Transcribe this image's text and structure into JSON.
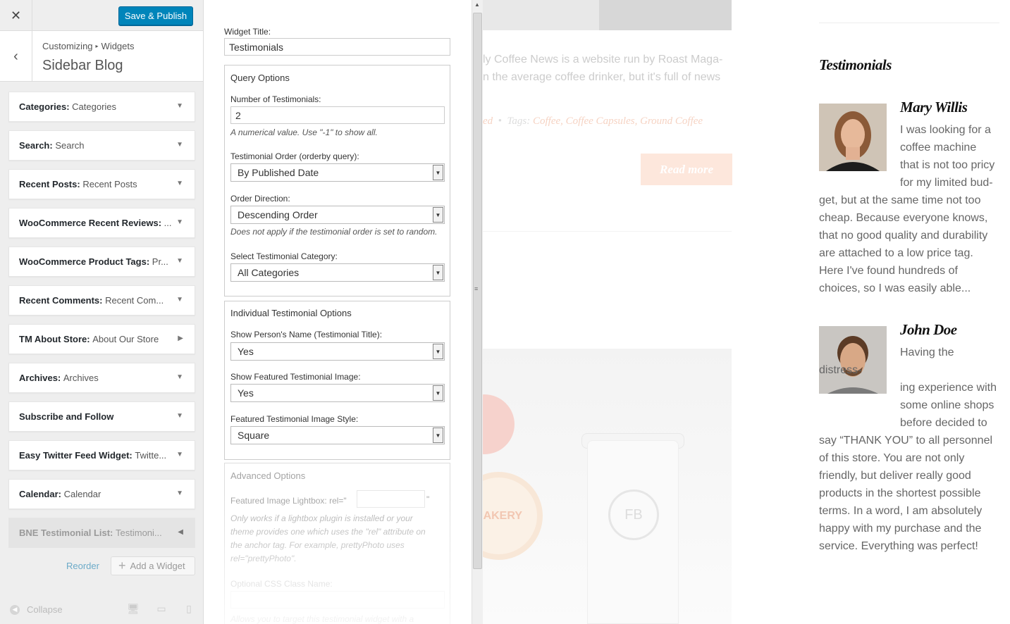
{
  "topbar": {
    "close_icon": "close-icon",
    "publish_label": "Save & Publish"
  },
  "header": {
    "crumb_1": "Customizing",
    "crumb_sep": "▸",
    "crumb_2": "Widgets",
    "title": "Sidebar Blog"
  },
  "widgets": [
    {
      "type": "Categories:",
      "title": "Categories",
      "arrow": "▼"
    },
    {
      "type": "Search:",
      "title": "Search",
      "arrow": "▼"
    },
    {
      "type": "Recent Posts:",
      "title": "Recent Posts",
      "arrow": "▼"
    },
    {
      "type": "WooCommerce Recent Reviews:",
      "title": "...",
      "arrow": "▼"
    },
    {
      "type": "WooCommerce Product Tags:",
      "title": "Pr...",
      "arrow": "▼"
    },
    {
      "type": "Recent Comments:",
      "title": "Recent Com...",
      "arrow": "▼"
    },
    {
      "type": "TM About Store:",
      "title": "About Our Store",
      "arrow": "▶"
    },
    {
      "type": "Archives:",
      "title": "Archives",
      "arrow": "▼"
    },
    {
      "type": "Subscribe and Follow",
      "title": "",
      "arrow": "▼"
    },
    {
      "type": "Easy Twitter Feed Widget:",
      "title": "Twitte...",
      "arrow": "▼"
    },
    {
      "type": "Calendar:",
      "title": "Calendar",
      "arrow": "▼"
    },
    {
      "type": "BNE Testimonial List:",
      "title": "Testimoni...",
      "arrow": "◀"
    }
  ],
  "widget_actions": {
    "reorder": "Reorder",
    "add_widget": "Add a Widget"
  },
  "footer": {
    "collapse": "Collapse"
  },
  "form": {
    "widget_title_label": "Widget Title:",
    "widget_title_value": "Testimonials",
    "query_heading": "Query Options",
    "num_label": "Number of Testimonials:",
    "num_value": "2",
    "num_hint": "A numerical value. Use \"-1\" to show all.",
    "order_label": "Testimonial Order (orderby query):",
    "order_value": "By Published Date",
    "direction_label": "Order Direction:",
    "direction_value": "Descending Order",
    "direction_hint": "Does not apply if the testimonial order is set to random.",
    "category_label": "Select Testimonial Category:",
    "category_value": "All Categories",
    "individual_heading": "Individual Testimonial Options",
    "name_label": "Show Person's Name (Testimonial Title):",
    "name_value": "Yes",
    "image_label": "Show Featured Testimonial Image:",
    "image_value": "Yes",
    "style_label": "Featured Testimonial Image Style:",
    "style_value": "Square",
    "advanced_heading": "Advanced Options",
    "lightbox_label": "Featured Image Lightbox: rel=\"",
    "lightbox_close": "\"",
    "lightbox_hint_1": "Only works if a lightbox plugin is installed or your",
    "lightbox_hint_2": "theme provides one which uses the \"rel\" attribute on",
    "lightbox_hint_3": "the anchor tag. For example, prettyPhoto uses",
    "lightbox_hint_4": "rel=\"prettyPhoto\".",
    "css_label": "Optional CSS Class Name:",
    "css_hint": "Allows you to target this testimonial widget with a"
  },
  "preview": {
    "post_line_1": "ly Coffee News is a website run by Roast Maga-",
    "post_line_2": "n the average coffee drinker, but it's full of news",
    "meta_ed": "ed",
    "meta_tags": "Tags:",
    "meta_tag_list": "Coffee, Coffee Capsules, Ground Coffee",
    "read_more": "Read more",
    "bag_text": "BAKERY",
    "cup_text": "FB",
    "aside_title": "Testimonials",
    "testimonials": [
      {
        "name": "Mary Willis",
        "lines": [
          "I was looking for a",
          "coffee machine",
          "that is not too pricy",
          "for my limited bud-",
          "get, but at the same time not too",
          "cheap. Because everyone knows,",
          "that no good quality and durability",
          "are attached to a low price tag.",
          "Here I've found hundreds of",
          "choices, so I was easily able..."
        ]
      },
      {
        "name": "John Doe",
        "lines": [
          "Having the distress-",
          "ing experience with",
          "some online shops",
          "before decided to",
          "say “THANK YOU” to all personnel",
          "of this store. You are not only",
          "friendly, but deliver really good",
          "products in the shortest possible",
          "terms. In a word, I am absolutely",
          "happy with my purchase and the",
          "service. Everything was perfect!"
        ]
      }
    ]
  },
  "colors": {
    "accent": "#0085ba",
    "sidebar_bg": "#eeeeee",
    "readmore_bg": "#fde7dc"
  }
}
